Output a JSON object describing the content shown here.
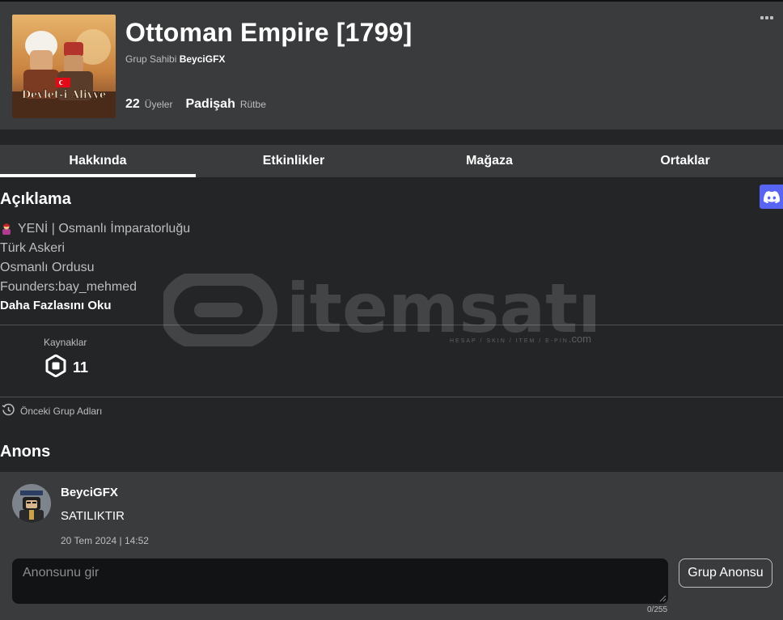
{
  "group": {
    "name": "Ottoman Empire [1799]",
    "owner_label": "Grup Sahibi",
    "owner_name": "BeyciGFX",
    "members_count": "22",
    "members_label": "Üyeler",
    "rank_value": "Padişah",
    "rank_label": "Rütbe",
    "image_caption": "Devlet-i Aliyye"
  },
  "tabs": [
    {
      "label": "Hakkında",
      "active": true
    },
    {
      "label": "Etkinlikler",
      "active": false
    },
    {
      "label": "Mağaza",
      "active": false
    },
    {
      "label": "Ortaklar",
      "active": false
    }
  ],
  "about": {
    "heading": "Açıklama",
    "lines": [
      "YENİ | Osmanlı İmparatorluğu",
      "Türk Askeri",
      "Osmanlı Ordusu",
      "Founders:bay_mehmed"
    ],
    "read_more": "Daha Fazlasını Oku"
  },
  "resources": {
    "label": "Kaynaklar",
    "robux": "11"
  },
  "previous_names_label": "Önceki Grup Adları",
  "shout": {
    "heading": "Anons",
    "poster": "BeyciGFX",
    "message": "SATILIKTIR",
    "date": "20 Tem 2024 | 14:52",
    "input_placeholder": "Anonsunu gir",
    "counter": "0/255",
    "button_label": "Grup Anonsu"
  },
  "watermark": {
    "brand": "itemsatış",
    "tagline": "HESAP / SKIN / ITEM / E-PIN",
    "suffix": ".com"
  },
  "colors": {
    "background": "#232527",
    "panel": "#393b3d",
    "discord": "#5865f2",
    "muted_text": "#bdbebe"
  },
  "icons": [
    "more-options-icon",
    "discord-icon",
    "robux-icon",
    "history-icon"
  ]
}
